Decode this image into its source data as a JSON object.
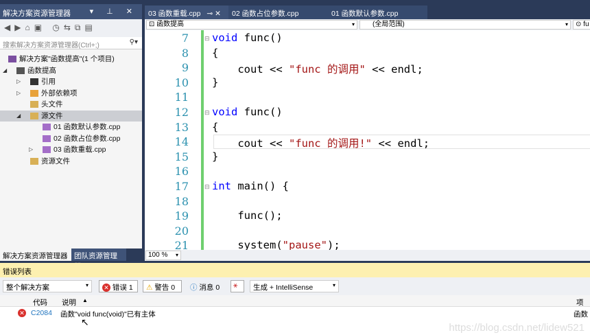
{
  "solution_explorer": {
    "title": "解决方案资源管理器",
    "controls": "▾ ⊥ ✕",
    "search_placeholder": "搜索解决方案资源管理器(Ctrl+;)",
    "tree": [
      {
        "label": "解决方案\"函数提高\"(1 个项目)"
      },
      {
        "label": "函数提高"
      },
      {
        "label": "引用"
      },
      {
        "label": "外部依赖项"
      },
      {
        "label": "头文件"
      },
      {
        "label": "源文件"
      },
      {
        "label": "01 函数默认参数.cpp"
      },
      {
        "label": "02 函数占位参数.cpp"
      },
      {
        "label": "03 函数重载.cpp"
      },
      {
        "label": "资源文件"
      }
    ],
    "bottom_tabs": [
      "解决方案资源管理器",
      "团队资源管理器"
    ]
  },
  "editor": {
    "tabs": [
      "03 函数重载.cpp",
      "02 函数占位参数.cpp",
      "01 函数默认参数.cpp"
    ],
    "project_dropdown": "函数提高",
    "scope_dropdown": "(全局范围)",
    "member_dropdown": "fu",
    "zoom": "100 %",
    "lines": [
      {
        "n": "7",
        "parts": [
          [
            "kw",
            "void"
          ],
          [
            "op",
            " func()"
          ]
        ]
      },
      {
        "n": "8",
        "parts": [
          [
            "op",
            "{"
          ]
        ]
      },
      {
        "n": "9",
        "parts": [
          [
            "op",
            "    cout << "
          ],
          [
            "str",
            "\"func 的调用\""
          ],
          [
            "op",
            " << endl;"
          ]
        ]
      },
      {
        "n": "10",
        "parts": [
          [
            "op",
            "}"
          ]
        ]
      },
      {
        "n": "11",
        "parts": []
      },
      {
        "n": "12",
        "parts": [
          [
            "kw",
            "void"
          ],
          [
            "op",
            " func()"
          ]
        ]
      },
      {
        "n": "13",
        "parts": [
          [
            "op",
            "{"
          ]
        ]
      },
      {
        "n": "14",
        "parts": [
          [
            "op",
            "    cout << "
          ],
          [
            "str",
            "\"func 的调用!\""
          ],
          [
            "op",
            " << endl;"
          ]
        ]
      },
      {
        "n": "15",
        "parts": [
          [
            "op",
            "}"
          ]
        ]
      },
      {
        "n": "16",
        "parts": []
      },
      {
        "n": "17",
        "parts": [
          [
            "kw",
            "int"
          ],
          [
            "op",
            " main() {"
          ]
        ]
      },
      {
        "n": "18",
        "parts": []
      },
      {
        "n": "19",
        "parts": [
          [
            "op",
            "    func();"
          ]
        ]
      },
      {
        "n": "20",
        "parts": []
      },
      {
        "n": "21",
        "parts": [
          [
            "op",
            "    system("
          ],
          [
            "str",
            "\"pause\""
          ],
          [
            "op",
            ");"
          ]
        ]
      }
    ]
  },
  "error_list": {
    "title": "错误列表",
    "scope": "整个解决方案",
    "errors_btn": "错误 1",
    "warnings_btn": "警告 0",
    "messages_btn": "消息 0",
    "build_filter": "生成 + IntelliSense",
    "columns": {
      "code": "代码",
      "description": "说明",
      "project": "项目"
    },
    "rows": [
      {
        "code": "C2084",
        "description": "函数\"void func(void)\"已有主体",
        "project": "函数"
      }
    ]
  },
  "watermark": "https://blog.csdn.net/lidew521"
}
